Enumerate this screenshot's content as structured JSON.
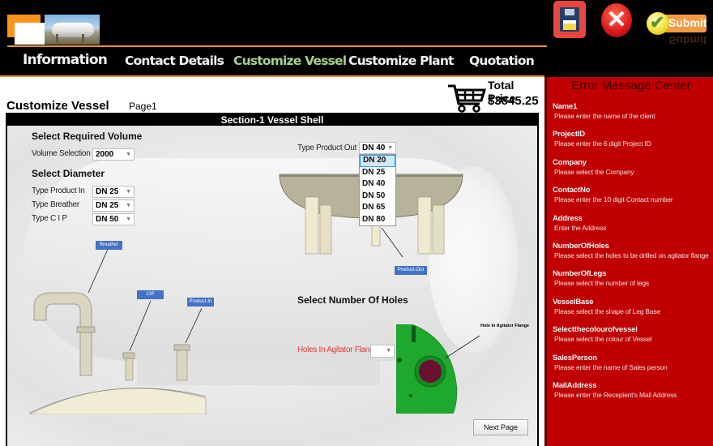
{
  "header": {
    "nav": [
      {
        "label": "Information",
        "active": false
      },
      {
        "label": "Contact Details",
        "active": false
      },
      {
        "label": "Customize Vessel",
        "active": true
      },
      {
        "label": "Customize Plant",
        "active": false
      },
      {
        "label": "Quotation",
        "active": false
      }
    ],
    "toolbar": {
      "save_icon": "floppy-disk-icon",
      "close_icon": "red-x-icon",
      "close_glyph": "✕",
      "submit_label": "Submit",
      "submit_glyph": "✔"
    }
  },
  "main": {
    "page_title": "Customize Vessel",
    "page_number": "Page1",
    "price": {
      "label": "Total Price",
      "value": "$3845.25"
    },
    "section_title": "Section-1 Vessel Shell",
    "volume": {
      "heading": "Select Required Volume",
      "label": "Volume Selection",
      "value": "2000"
    },
    "diameter": {
      "heading": "Select Diameter",
      "fields": [
        {
          "label": "Type Product In",
          "value": "DN 25"
        },
        {
          "label": "Type Breather",
          "value": "DN 25"
        },
        {
          "label": "Type C I P",
          "value": "DN 50"
        }
      ]
    },
    "product_out": {
      "label": "Type Product Out",
      "value": "DN 40",
      "options": [
        "DN 20",
        "DN 25",
        "DN 40",
        "DN 50",
        "DN 65",
        "DN 80"
      ],
      "highlighted": "DN 20"
    },
    "callouts": {
      "breather": "Breather",
      "cip": "CIP",
      "product_in": "Product-In",
      "product_out": "Product-Out",
      "flange_hole": "Hole In Agitator Flange"
    },
    "holes": {
      "heading": "Select Number Of Holes",
      "label": "Holes In Agitator Flange",
      "value": ""
    },
    "next_label": "Next Page"
  },
  "sidebar": {
    "title": "Error Message Center",
    "errors": [
      {
        "field": "Name1",
        "message": "Please enter the name of the client"
      },
      {
        "field": "ProjectID",
        "message": "Please enter the 6 digit Project ID"
      },
      {
        "field": "Company",
        "message": "Please select the Company"
      },
      {
        "field": "ContactNo",
        "message": "Please enter the 10 digit Contact number"
      },
      {
        "field": "Address",
        "message": "Enter the Address"
      },
      {
        "field": "NumberOfHoles",
        "message": "Please select the holes to be drilled on agitator flange"
      },
      {
        "field": "NumberOfLegs",
        "message": "Please select the number of legs"
      },
      {
        "field": "VesselBase",
        "message": "Please select the shape of Leg Base"
      },
      {
        "field": "Selectthecolourofvessel",
        "message": "Please select the colour of Vessel"
      },
      {
        "field": "SalesPerson",
        "message": "Please enter the name of Sales person"
      },
      {
        "field": "MailAddress",
        "message": "Please enter the Recepient's Mail Address"
      }
    ]
  },
  "colors": {
    "accent_orange": "#f7931e",
    "active_nav": "#a8d08d",
    "sidebar_red": "#c00000",
    "callout_blue": "#4472c4",
    "flange_green": "#1fa82e",
    "error_text_red": "#e03a3e"
  }
}
